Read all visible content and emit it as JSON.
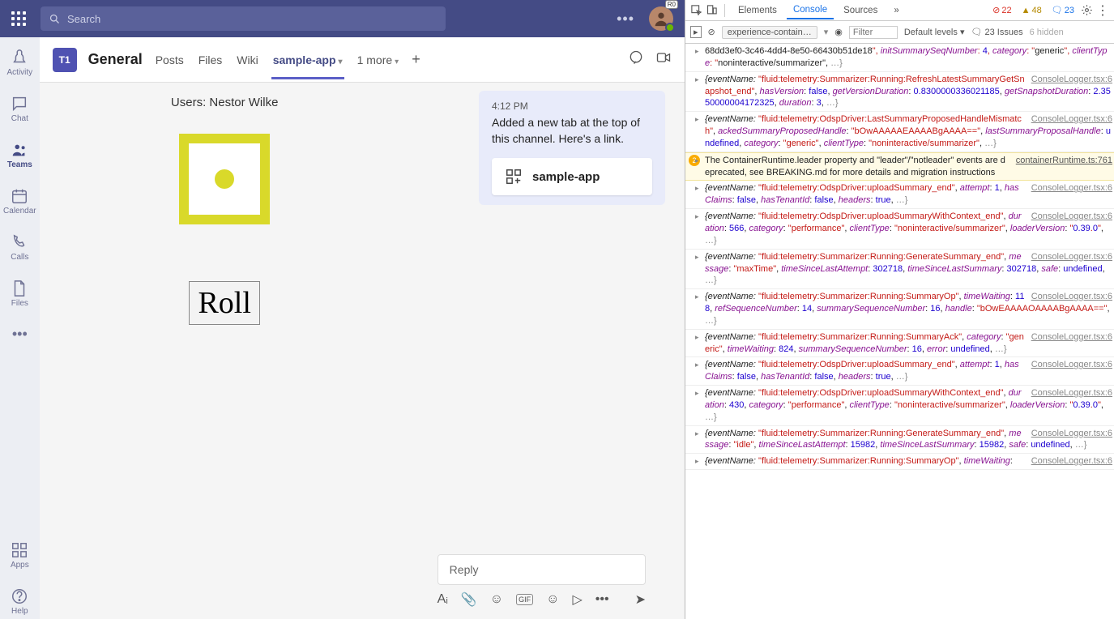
{
  "topbar": {
    "search_placeholder": "Search",
    "dots": "…"
  },
  "rail": {
    "items": [
      {
        "label": "Activity"
      },
      {
        "label": "Chat"
      },
      {
        "label": "Teams"
      },
      {
        "label": "Calendar"
      },
      {
        "label": "Calls"
      },
      {
        "label": "Files"
      }
    ],
    "apps": "Apps",
    "help": "Help"
  },
  "channel": {
    "icon": "T1",
    "name": "General",
    "tabs": {
      "posts": "Posts",
      "files": "Files",
      "wiki": "Wiki",
      "app": "sample-app",
      "more": "1 more"
    }
  },
  "dice": {
    "users": "Users: Nestor Wilke",
    "roll": "Roll"
  },
  "message": {
    "time": "4:12 PM",
    "body": "Added a new tab at the top of this channel. Here's a link.",
    "app": "sample-app"
  },
  "compose": {
    "reply": "Reply"
  },
  "devtools": {
    "tabs": {
      "elements": "Elements",
      "console": "Console",
      "sources": "Sources"
    },
    "stats": {
      "err": "22",
      "warn": "48",
      "info": "23"
    },
    "issues": "23 Issues",
    "hidden": "6 hidden",
    "context": "experience-contain…",
    "filter": "Filter",
    "levels": "Default levels",
    "warn_src": "containerRuntime.ts:761",
    "src": "ConsoleLogger.tsx:6",
    "warn_text": "The ContainerRuntime.leader property and \"leader\"/\"notleader\" events are deprecated, see BREAKING.md for more details and migration instructions",
    "rows": [
      {
        "pre": "68dd3ef0-3c46-4dd4-8e50-66430b51de18\", initSummarySeqNumber: 4, category: \"generic\", clientType: \"noninteractive/summarizer\", …}"
      },
      {
        "ev": "fluid:telemetry:Summarizer:Running:RefreshLatestSummaryGetSnapshot_end",
        "rest": ", hasVersion: false, getVersionDuration: 0.8300000336021185, getSnapshotDuration: 2.3550000004172325, duration: 3, …}"
      },
      {
        "ev": "fluid:telemetry:OdspDriver:LastSummaryProposedHandleMismatch",
        "rest": ", ackedSummaryProposedHandle: \"bOwAAAAAEAAAABgAAAA==\", lastSummaryProposalHandle: undefined, category: \"generic\", clientType: \"noninteractive/summarizer\", …}"
      },
      {
        "ev": "fluid:telemetry:OdspDriver:uploadSummary_end",
        "rest": ", attempt: 1, hasClaims: false, hasTenantId: false, headers: true, …}"
      },
      {
        "ev": "fluid:telemetry:OdspDriver:uploadSummaryWithContext_end",
        "rest": ", duration: 566, category: \"performance\", clientType: \"noninteractive/summarizer\", loaderVersion: \"0.39.0\", …}"
      },
      {
        "ev": "fluid:telemetry:Summarizer:Running:GenerateSummary_end",
        "rest": ", message: \"maxTime\", timeSinceLastAttempt: 302718, timeSinceLastSummary: 302718, safe: undefined, …}"
      },
      {
        "ev": "fluid:telemetry:Summarizer:Running:SummaryOp",
        "rest": ", timeWaiting: 118, refSequenceNumber: 14, summarySequenceNumber: 16, handle: \"bOwEAAAAOAAAABgAAAA==\", …}"
      },
      {
        "ev": "fluid:telemetry:Summarizer:Running:SummaryAck",
        "rest": ", category: \"generic\", timeWaiting: 824, summarySequenceNumber: 16, error: undefined, …}"
      },
      {
        "ev": "fluid:telemetry:OdspDriver:uploadSummary_end",
        "rest": ", attempt: 1, hasClaims: false, hasTenantId: false, headers: true, …}"
      },
      {
        "ev": "fluid:telemetry:OdspDriver:uploadSummaryWithContext_end",
        "rest": ", duration: 430, category: \"performance\", clientType: \"noninteractive/summarizer\", loaderVersion: \"0.39.0\", …}"
      },
      {
        "ev": "fluid:telemetry:Summarizer:Running:GenerateSummary_end",
        "rest": ", message: \"idle\", timeSinceLastAttempt: 15982, timeSinceLastSummary: 15982, safe: undefined, …}"
      },
      {
        "ev": "fluid:telemetry:Summarizer:Running:SummaryOp",
        "rest": ", timeWaiting:"
      }
    ]
  }
}
